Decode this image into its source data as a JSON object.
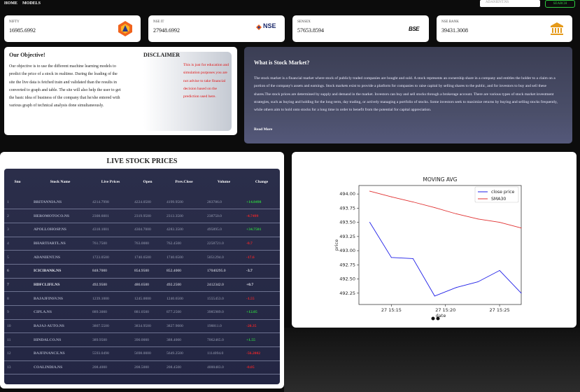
{
  "nav": {
    "home": "HOME",
    "models": "MODELS"
  },
  "search": {
    "placeholder": "ADANIENT.NS",
    "button": "SEARCH"
  },
  "indices": [
    {
      "name": "NIFTY",
      "value": "16985.6992"
    },
    {
      "name": "NSE IT",
      "value": "27948.6992"
    },
    {
      "name": "SENSEX",
      "value": "57653.8594"
    },
    {
      "name": "NSE BANK",
      "value": "39431.3008"
    }
  ],
  "logos": {
    "nse_text": "NSE",
    "bse_text": "BSE"
  },
  "objective": {
    "title": "Our Objective!",
    "text": "Our objective is to use the different machine learning models to predict the price of a stock in realtime. During the loading of the site the live data is fetched train and validated than the results in converted to graph and table. The site will also help the user to get the basic idea of business of the company that he/she entered with various graph of technical analysis done simultaneously."
  },
  "disclaimer": {
    "title": "DISCLAIMER",
    "text": "This is just for education and simulation purposes you are not advise to take financial decision based on the prediction used here."
  },
  "market": {
    "title": "What is Stock Market?",
    "text": "The stock market is a financial market where stock of publicly traded companies are bought and sold. A stock represents an ownership share in a company and entitles the holder to a claim on a portion of the company's assets and earnings. Stock markets exist to provide a platform for companies to raise capital by selling shares to the public, and for investors to buy and sell these shares.The stock prices are determined by supply and demand in the market. Investors can buy and sell stocks through a brokerage account. There are various types of stock market investment strategies, such as buying and holding for the long term, day trading, or actively managing a portfolio of stocks. Some investors seek to maximize returns by buying and selling stocks frequently, while others aim to hold onto stocks for a long time in order to benefit from the potential for capital appreciation.",
    "link": "Read More"
  },
  "live_table": {
    "title": "LIVE STOCK PRICES",
    "headers": [
      "Sno",
      "Stock Name",
      "Live Prices",
      "Open",
      "Prev.Close",
      "Volume",
      "Change"
    ],
    "rows": [
      [
        "1",
        "BRITANNIA.NS",
        "4214.7998",
        "4224.0500",
        "4199.9500",
        "283786.0",
        "+14.8498"
      ],
      [
        "2",
        "HEROMOTOCO.NS",
        "2308.6001",
        "2319.9500",
        "2313.3500",
        "238750.0",
        "-4.7499"
      ],
      [
        "3",
        "APOLLOHOSP.NS",
        "4318.1001",
        "4304.7000",
        "4283.3500",
        "495895.0",
        "+34.7501"
      ],
      [
        "4",
        "BHARTIARTL.NS",
        "761.7500",
        "763.0000",
        "762.4500",
        "2258721.0",
        "-0.7"
      ],
      [
        "5",
        "ADANIENT.NS",
        "1723.0500",
        "1740.6500",
        "1740.6500",
        "5051294.0",
        "-17.6"
      ],
      [
        "6",
        "ICICIBANK.NS",
        "848.7000",
        "854.9500",
        "852.4000",
        "17040295.0",
        "-3.7"
      ],
      [
        "7",
        "HDFCLIFE.NS",
        "492.9500",
        "486.6500",
        "492.2500",
        "2412342.0",
        "+0.7"
      ],
      [
        "8",
        "BAJAJFINSV.NS",
        "1239.1000",
        "1245.0000",
        "1240.6500",
        "1555453.0",
        "-1.55"
      ],
      [
        "9",
        "CIPLA.NS",
        "889.3000",
        "881.0500",
        "877.2500",
        "3985989.0",
        "+12.05"
      ],
      [
        "10",
        "BAJAJ-AUTO.NS",
        "3807.5500",
        "3834.9500",
        "3827.9000",
        "198811.0",
        "-20.35"
      ],
      [
        "11",
        "HINDALCO.NS",
        "389.9500",
        "390.0000",
        "388.4000",
        "7062465.0",
        "+1.55"
      ],
      [
        "12",
        "BAJFINANCE.NS",
        "5593.0498",
        "5698.0000",
        "5649.2500",
        "1114094.0",
        "-56.2002"
      ],
      [
        "13",
        "COALINDIA.NS",
        "208.4000",
        "208.5000",
        "208.4500",
        "4000483.0",
        "-0.05"
      ]
    ]
  },
  "chart_data": {
    "type": "line",
    "title": "MOVING AVG",
    "xlabel": "date",
    "ylabel": "price",
    "x_ticks": [
      "27 15:15",
      "27 15:20",
      "27 15:25"
    ],
    "y_ticks": [
      "492.25",
      "492.50",
      "492.75",
      "493.00",
      "493.25",
      "493.50",
      "493.75",
      "494.00"
    ],
    "ylim": [
      492.05,
      494.15
    ],
    "x_range_minutes": [
      -3,
      12
    ],
    "x_tick_minutes": [
      0,
      5,
      10
    ],
    "legend_position": "top-right",
    "series": [
      {
        "name": "close price",
        "color": "#1f1fe8",
        "x_minutes": [
          -2,
          0,
          2,
          4,
          6,
          8,
          10,
          12
        ],
        "values": [
          493.5,
          492.88,
          492.86,
          492.2,
          492.35,
          492.45,
          492.65,
          492.25
        ]
      },
      {
        "name": "SMA30",
        "color": "#e03030",
        "x_minutes": [
          -2,
          0,
          2,
          4,
          6,
          8,
          10,
          12
        ],
        "values": [
          494.05,
          493.95,
          493.86,
          493.76,
          493.65,
          493.56,
          493.5,
          493.4
        ]
      }
    ]
  }
}
